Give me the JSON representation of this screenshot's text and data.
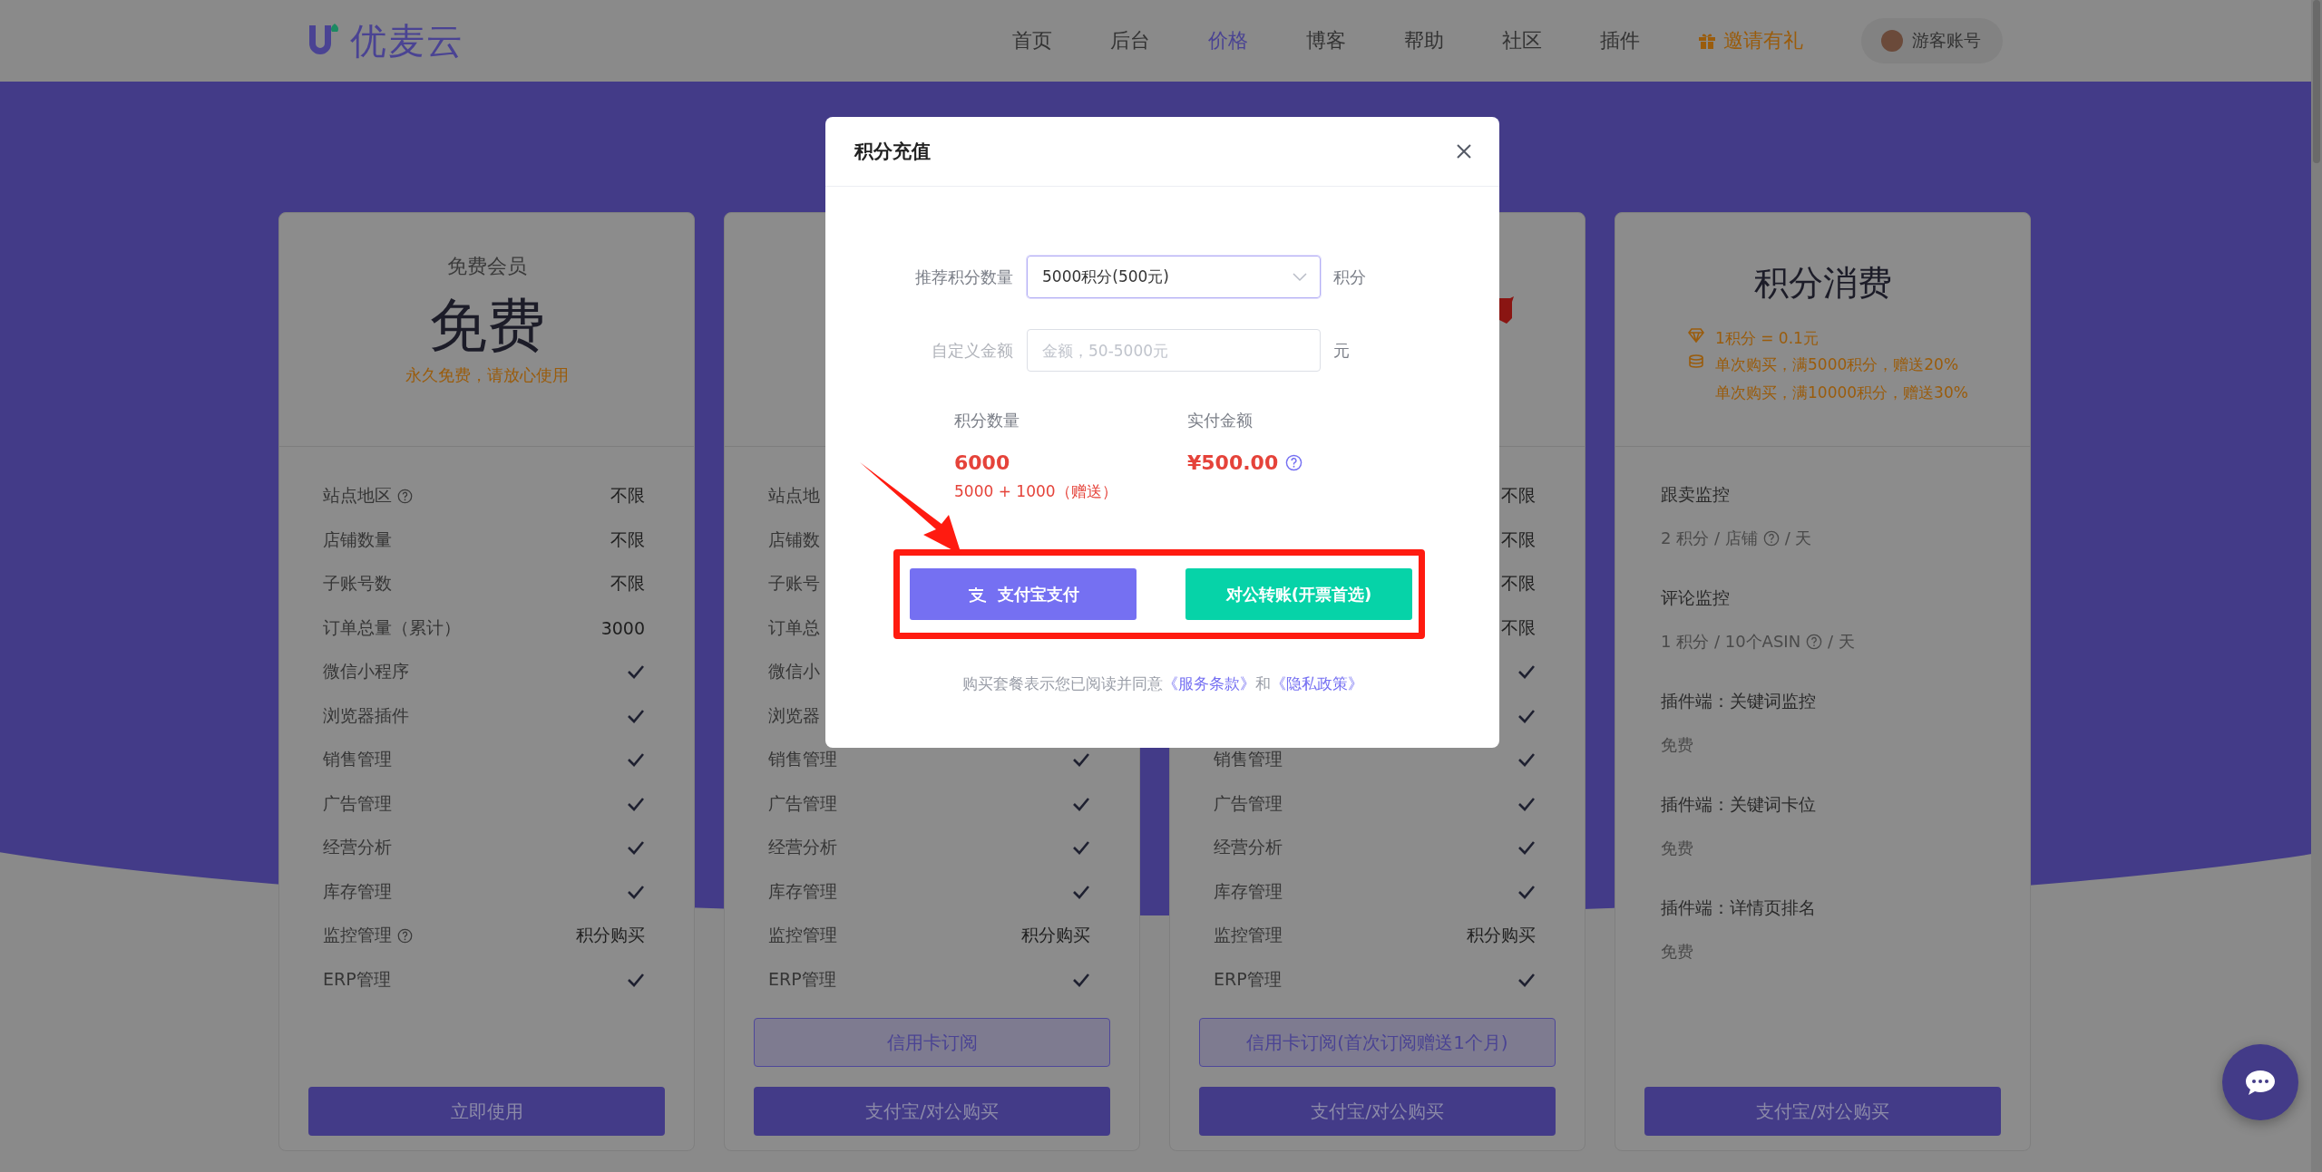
{
  "header": {
    "logo": "优麦云",
    "nav": [
      {
        "label": "首页",
        "selected": false
      },
      {
        "label": "后台",
        "selected": false
      },
      {
        "label": "价格",
        "selected": true
      },
      {
        "label": "博客",
        "selected": false
      },
      {
        "label": "帮助",
        "selected": false
      },
      {
        "label": "社区",
        "selected": false
      },
      {
        "label": "插件",
        "selected": false
      }
    ],
    "invite": "邀请有礼",
    "account": "游客账号"
  },
  "plans": [
    {
      "name": "免费会员",
      "price": "免费",
      "note": "永久免费，请放心使用",
      "features": [
        {
          "label": "站点地区",
          "help": true,
          "kind": "text",
          "value": "不限"
        },
        {
          "label": "店铺数量",
          "kind": "text",
          "value": "不限"
        },
        {
          "label": "子账号数",
          "kind": "text",
          "value": "不限"
        },
        {
          "label": "订单总量（累计）",
          "kind": "text",
          "value": "3000"
        },
        {
          "label": "微信小程序",
          "kind": "check"
        },
        {
          "label": "浏览器插件",
          "kind": "check"
        },
        {
          "label": "销售管理",
          "kind": "check"
        },
        {
          "label": "广告管理",
          "kind": "check"
        },
        {
          "label": "经营分析",
          "kind": "check"
        },
        {
          "label": "库存管理",
          "kind": "check"
        },
        {
          "label": "监控管理",
          "help": true,
          "kind": "text",
          "value": "积分购买"
        },
        {
          "label": "ERP管理",
          "kind": "check"
        }
      ],
      "buttons": [
        {
          "label": "立即使用",
          "kind": "solid"
        }
      ]
    },
    {
      "features": [
        {
          "label": "站点地",
          "kind": "none"
        },
        {
          "label": "店铺数",
          "kind": "none"
        },
        {
          "label": "子账号",
          "kind": "none"
        },
        {
          "label": "订单总",
          "kind": "none"
        },
        {
          "label": "微信小",
          "kind": "none"
        },
        {
          "label": "浏览器",
          "kind": "none"
        },
        {
          "label": "销售管理",
          "kind": "check"
        },
        {
          "label": "广告管理",
          "kind": "check"
        },
        {
          "label": "经营分析",
          "kind": "check"
        },
        {
          "label": "库存管理",
          "kind": "check"
        },
        {
          "label": "监控管理",
          "kind": "text",
          "value": "积分购买"
        },
        {
          "label": "ERP管理",
          "kind": "check"
        }
      ],
      "buttons": [
        {
          "label": "信用卡订阅",
          "kind": "outline"
        },
        {
          "label": "支付宝/对公购买",
          "kind": "solid"
        }
      ]
    },
    {
      "ribbon": true,
      "features": [
        {
          "kind": "text",
          "value": "不限"
        },
        {
          "kind": "text",
          "value": "不限"
        },
        {
          "kind": "text",
          "value": "不限"
        },
        {
          "kind": "text",
          "value": "不限"
        },
        {
          "kind": "check"
        },
        {
          "kind": "check"
        },
        {
          "label": "销售管理",
          "kind": "check"
        },
        {
          "label": "广告管理",
          "kind": "check"
        },
        {
          "label": "经营分析",
          "kind": "check"
        },
        {
          "label": "库存管理",
          "kind": "check"
        },
        {
          "label": "监控管理",
          "kind": "text",
          "value": "积分购买"
        },
        {
          "label": "ERP管理",
          "kind": "check"
        }
      ],
      "buttons": [
        {
          "label": "信用卡订阅(首次订阅赠送1个月)",
          "kind": "outline"
        },
        {
          "label": "支付宝/对公购买",
          "kind": "solid"
        }
      ]
    }
  ],
  "points_card": {
    "title": "积分消费",
    "perks": [
      {
        "kind": "gem",
        "lines": [
          "1积分 = 0.1元"
        ]
      },
      {
        "kind": "coins",
        "lines": [
          "单次购买，满5000积分，赠送20%",
          "单次购买，满10000积分，赠送30%"
        ]
      }
    ],
    "items": [
      {
        "title": "跟卖监控",
        "detail": "2 积分 / 店铺",
        "help": true,
        "detail_after": "/ 天"
      },
      {
        "title": "评论监控",
        "detail": "1 积分 / 10个ASIN",
        "help": true,
        "detail_after": "/ 天"
      },
      {
        "title": "插件端：关键词监控",
        "detail": "免费"
      },
      {
        "title": "插件端：关键词卡位",
        "detail": "免费"
      },
      {
        "title": "插件端：详情页排名",
        "detail": "免费"
      }
    ],
    "button": "支付宝/对公购买"
  },
  "modal": {
    "title": "积分充值",
    "fields": [
      {
        "kind": "select",
        "label": "推荐积分数量",
        "value": "5000积分(500元)",
        "unit": "积分",
        "focused": true
      },
      {
        "kind": "input",
        "label": "自定义金额",
        "placeholder": "金额，50-5000元",
        "unit": "元",
        "focused": false
      }
    ],
    "summary": [
      {
        "label": "积分数量",
        "value": "6000",
        "sub": "5000 + 1000（赠送）"
      },
      {
        "label": "实付金额",
        "value": "¥500.00",
        "help": true
      }
    ],
    "buttons": [
      {
        "kind": "alipay",
        "label": "支付宝支付"
      },
      {
        "kind": "transfer",
        "label": "对公转账(开票首选)"
      }
    ],
    "agreement": {
      "text": "购买套餐表示您已阅读并同意",
      "links": [
        "《服务条款》",
        "《隐私政策》"
      ],
      "joiner": "和"
    }
  }
}
